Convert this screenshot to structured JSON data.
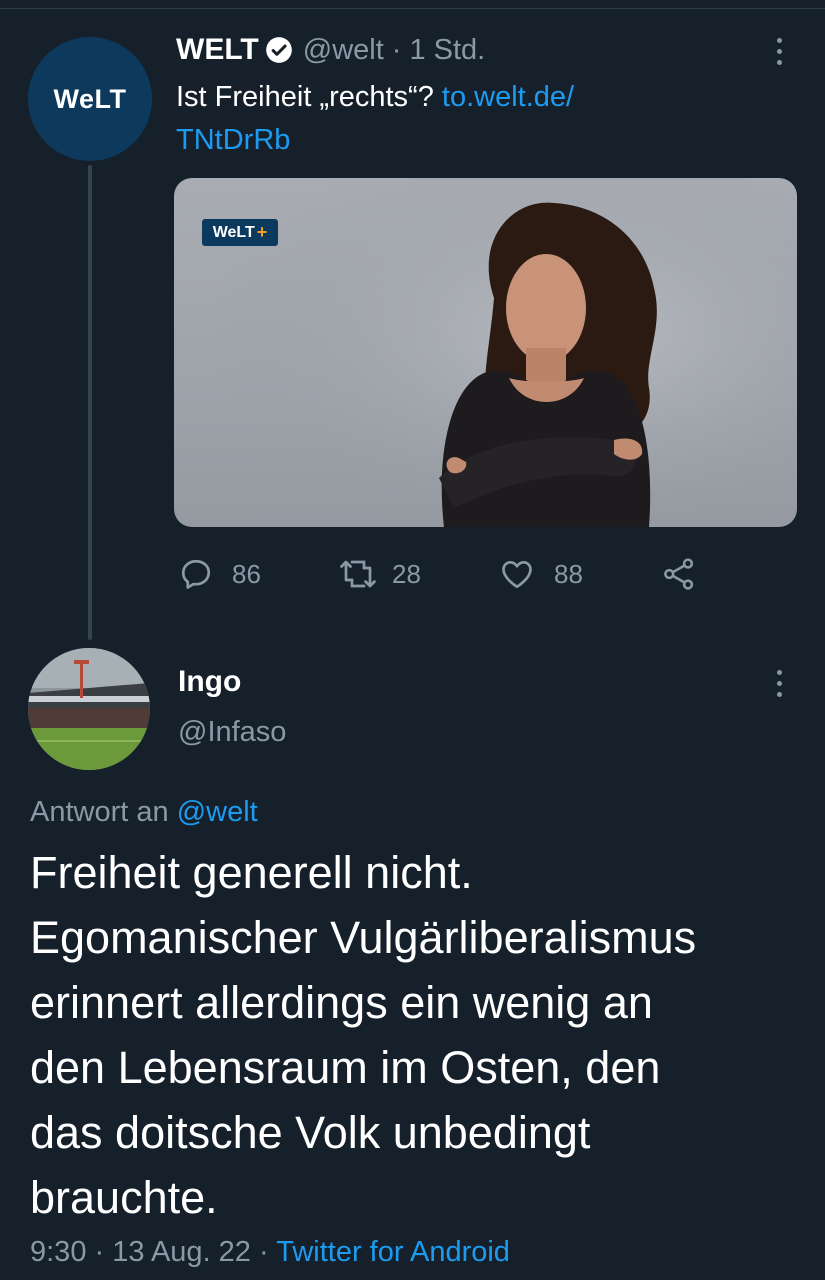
{
  "parent_tweet": {
    "avatar_text": "WeLT",
    "name": "WELT",
    "handle": "@welt",
    "separator": "·",
    "time": "1 Std.",
    "text": "Ist Freiheit „rechts“? ",
    "link_line1": "to.welt.de/",
    "link_line2": "TNtDrRb",
    "media_badge": "WeLT",
    "media_badge_plus": "+",
    "replies": "86",
    "retweets": "28",
    "likes": "88"
  },
  "reply_tweet": {
    "name": "Ingo",
    "handle": "@Infaso",
    "reply_prefix": "Antwort an ",
    "reply_target": "@welt",
    "text": "Freiheit generell nicht.\nEgomanischer Vulgärliberalismus\nerinnert allerdings ein wenig an\nden Lebensraum im Osten, den\ndas doitsche Volk unbedingt\nbrauchte.",
    "time": "9:30",
    "date": "13 Aug. 22",
    "separator": "·",
    "source": "Twitter for Android"
  },
  "colors": {
    "background": "#15202b",
    "secondary_text": "#8b98a5",
    "link": "#1d9bf0",
    "welt_blue": "#0d3a5c"
  },
  "icons": [
    "verified-badge-icon",
    "more-options-icon",
    "reply-icon",
    "retweet-icon",
    "like-icon",
    "share-icon"
  ]
}
